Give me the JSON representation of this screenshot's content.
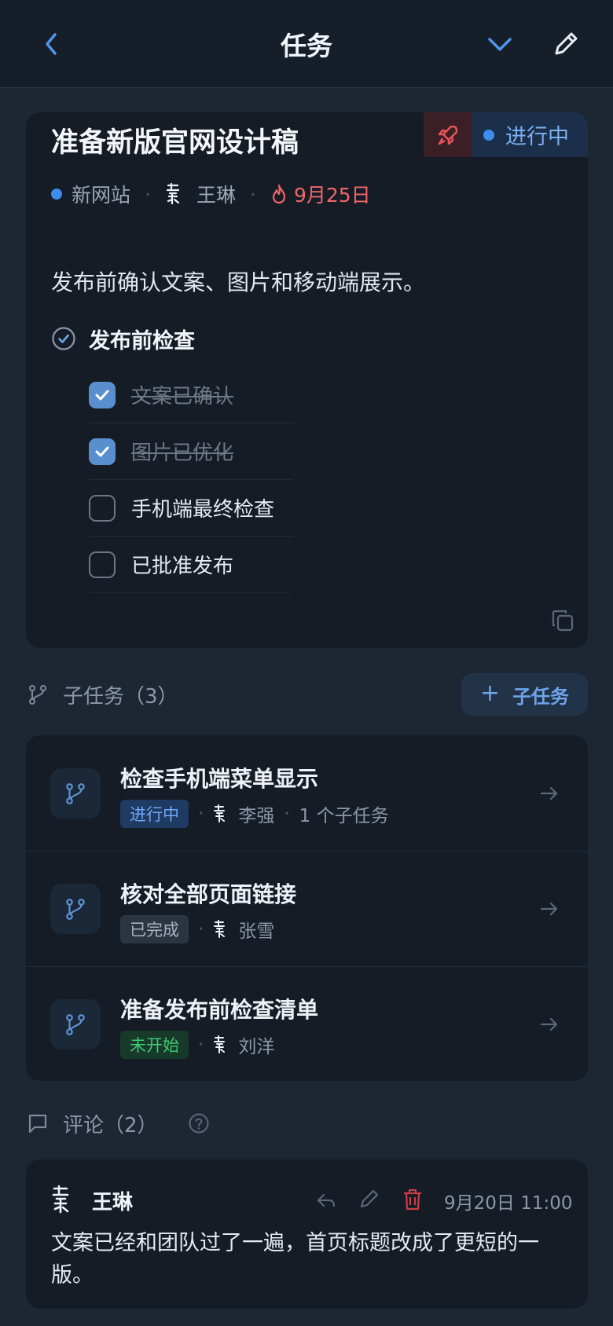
{
  "header": {
    "title": "任务"
  },
  "task": {
    "title": "准备新版官网设计稿",
    "status": "进行中",
    "project": "新网站",
    "assignee": "王琳",
    "due": "9月25日",
    "description": "发布前确认文案、图片和移动端展示。",
    "checklist": {
      "title": "发布前检查",
      "items": [
        {
          "label": "文案已确认",
          "checked": true
        },
        {
          "label": "图片已优化",
          "checked": true
        },
        {
          "label": "手机端最终检查",
          "checked": false
        },
        {
          "label": "已批准发布",
          "checked": false
        }
      ]
    }
  },
  "subtasks": {
    "title": "子任务（3）",
    "add_label": "子任务",
    "items": [
      {
        "name": "检查手机端菜单显示",
        "status": "进行中",
        "assignee": "李强",
        "extra": "1 个子任务"
      },
      {
        "name": "核对全部页面链接",
        "status": "已完成",
        "assignee": "张雪"
      },
      {
        "name": "准备发布前检查清单",
        "status": "未开始",
        "assignee": "刘洋"
      }
    ]
  },
  "comments": {
    "title": "评论（2）",
    "items": [
      {
        "author": "王琳",
        "time": "9月20日 11:00",
        "body": "文案已经和团队过了一遍，首页标题改成了更短的一版。"
      }
    ]
  },
  "colors": {
    "accent": "#3d8cf0",
    "danger": "#f06767",
    "success": "#3ecb72"
  }
}
